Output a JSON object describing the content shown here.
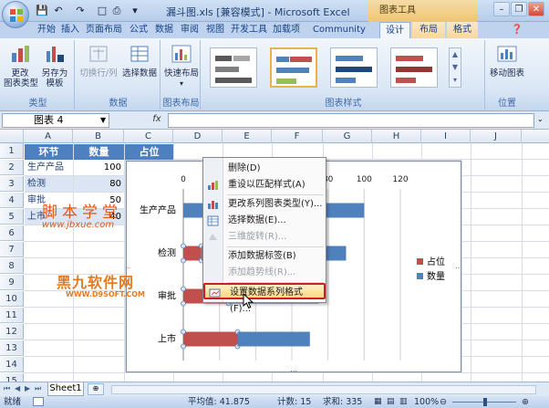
{
  "window": {
    "title": "漏斗图.xls [兼容模式] - Microsoft Excel",
    "context_tab_group": "图表工具",
    "minimize": "–",
    "restore": "❐",
    "close": "✕"
  },
  "tabs": [
    "开始",
    "插入",
    "页面布局",
    "公式",
    "数据",
    "审阅",
    "视图",
    "开发工具",
    "加载项",
    "Community Clips",
    "设计",
    "布局",
    "格式"
  ],
  "active_tab": "设计",
  "ribbon": {
    "groups": [
      {
        "label": "类型",
        "buttons": [
          "更改\n图表类型",
          "另存为\n模板"
        ]
      },
      {
        "label": "数据",
        "buttons": [
          "切换行/列",
          "选择数据"
        ]
      },
      {
        "label": "图表布局",
        "buttons": [
          "快速布局"
        ]
      },
      {
        "label": "图表样式",
        "buttons": []
      },
      {
        "label": "位置",
        "buttons": [
          "移动图表"
        ]
      }
    ],
    "change_type": "更改\n图表类型",
    "save_template": "另存为\n模板",
    "switch_rowcol": "切换行/列",
    "select_data": "选择数据",
    "quick_layout": "快速布局",
    "move_chart": "移动图表",
    "label_type": "类型",
    "label_data": "数据",
    "label_layout": "图表布局",
    "label_styles": "图表样式",
    "label_position": "位置"
  },
  "formula_bar": {
    "name_box": "图表 4",
    "fx": "fx",
    "value": ""
  },
  "columns": [
    "A",
    "B",
    "C",
    "D",
    "E",
    "F",
    "G",
    "H",
    "I",
    "J"
  ],
  "rows": [
    "1",
    "2",
    "3",
    "4",
    "5",
    "6",
    "7",
    "8",
    "9",
    "10",
    "11",
    "12",
    "13",
    "14",
    "15"
  ],
  "table": {
    "headers": [
      "环节",
      "数量",
      "占位"
    ],
    "rows": [
      [
        "生产产品",
        "100",
        ""
      ],
      [
        "检测",
        "80",
        ""
      ],
      [
        "审批",
        "50",
        ""
      ],
      [
        "上市",
        "40",
        ""
      ]
    ]
  },
  "chart_data": {
    "type": "bar",
    "orientation": "horizontal",
    "stacked": true,
    "categories": [
      "生产产品",
      "检测",
      "审批",
      "上市"
    ],
    "series": [
      {
        "name": "占位",
        "values": [
          0,
          10,
          25,
          30
        ],
        "color": "#c0504d"
      },
      {
        "name": "数量",
        "values": [
          100,
          80,
          50,
          40
        ],
        "color": "#4f81bd"
      }
    ],
    "xlim": [
      0,
      120
    ],
    "xticks": [
      "0",
      "20",
      "40",
      "60",
      "80",
      "100",
      "120"
    ],
    "x_axis_position": "top",
    "legend_position": "right",
    "gridlines": true
  },
  "context_menu": {
    "items": [
      {
        "label": "删除(D)",
        "enabled": true,
        "icon": "delete-icon"
      },
      {
        "label": "重设以匹配样式(A)",
        "enabled": true,
        "icon": "reset-style-icon"
      },
      {
        "label": "更改系列图表类型(Y)...",
        "enabled": true,
        "icon": "chart-type-icon"
      },
      {
        "label": "选择数据(E)...",
        "enabled": true,
        "icon": "select-data-icon"
      },
      {
        "label": "三维旋转(R)...",
        "enabled": false,
        "icon": "3d-rotate-icon"
      },
      {
        "label": "添加数据标签(B)",
        "enabled": true,
        "icon": ""
      },
      {
        "label": "添加趋势线(R)...",
        "enabled": false,
        "icon": ""
      },
      {
        "label": "设置数据系列格式(F)...",
        "enabled": true,
        "icon": "format-series-icon",
        "highlighted": true
      }
    ]
  },
  "watermarks": {
    "cn": "脚本学堂",
    "url": "www.jbxue.com",
    "logo": "黑九软件网",
    "logo_url": "WWW.D9SOFT.COM"
  },
  "sheet_tab": "Sheet1",
  "status": {
    "ready": "就绪",
    "average": "平均值: 41.875",
    "count": "计数: 15",
    "sum": "求和: 335",
    "zoom": "100%"
  }
}
